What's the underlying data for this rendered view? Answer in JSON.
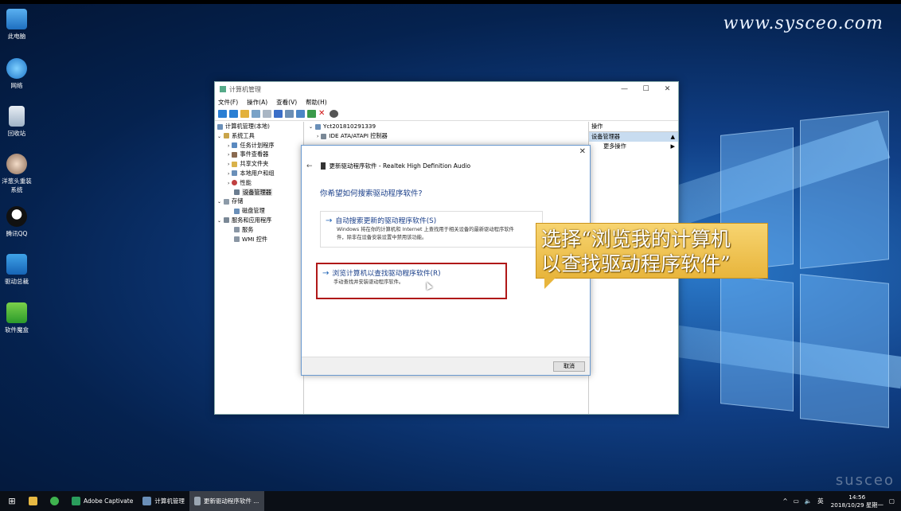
{
  "watermark": "www.sysceo.com",
  "desktop_icons": [
    {
      "label": "此电脑"
    },
    {
      "label": "网络"
    },
    {
      "label": "回收站"
    },
    {
      "label": "洋葱头重装系统"
    },
    {
      "label": "腾讯QQ"
    },
    {
      "label": "驱动总裁"
    },
    {
      "label": "软件魔盒"
    }
  ],
  "window": {
    "title": "计算机管理",
    "menu": [
      "文件(F)",
      "操作(A)",
      "查看(V)",
      "帮助(H)"
    ],
    "tree": [
      {
        "label": "计算机管理(本地)",
        "level": 0
      },
      {
        "label": "系统工具",
        "level": 1
      },
      {
        "label": "任务计划程序",
        "level": 2
      },
      {
        "label": "事件查看器",
        "level": 2
      },
      {
        "label": "共享文件夹",
        "level": 2
      },
      {
        "label": "本地用户和组",
        "level": 2
      },
      {
        "label": "性能",
        "level": 2
      },
      {
        "label": "设备管理器",
        "level": 2
      },
      {
        "label": "存储",
        "level": 1
      },
      {
        "label": "磁盘管理",
        "level": 2
      },
      {
        "label": "服务和应用程序",
        "level": 1
      },
      {
        "label": "服务",
        "level": 2
      },
      {
        "label": "WMI 控件",
        "level": 2
      }
    ],
    "center": {
      "root": "Yct201810291339",
      "item": "IDE ATA/ATAPI 控制器"
    },
    "actions": {
      "header": "操作",
      "selected": "设备管理器",
      "more": "更多操作"
    }
  },
  "dialog": {
    "title": "更新驱动程序软件 - Realtek High Definition Audio",
    "question": "你希望如何搜索驱动程序软件?",
    "option1_title": "自动搜索更新的驱动程序软件(S)",
    "option1_desc_line1": "Windows 将在你的计算机和 Internet 上查找用于相关设备的最新驱动程序软件",
    "option1_desc_line2": "件，除非在设备安装设置中禁用该功能。",
    "option2_title": "浏览计算机以查找驱动程序软件(R)",
    "option2_desc": "手动查找并安装驱动程序软件。",
    "cancel": "取消"
  },
  "callout": {
    "line1": "选择“浏览我的计算机",
    "line2": "以查找驱动程序软件”"
  },
  "taskbar": {
    "items": [
      "Adobe Captivate",
      "计算机管理",
      "更新驱动程序软件 ..."
    ],
    "ime": "英",
    "time": "14:56",
    "date": "2018/10/29 星期一"
  },
  "brand_logo": "susceo"
}
